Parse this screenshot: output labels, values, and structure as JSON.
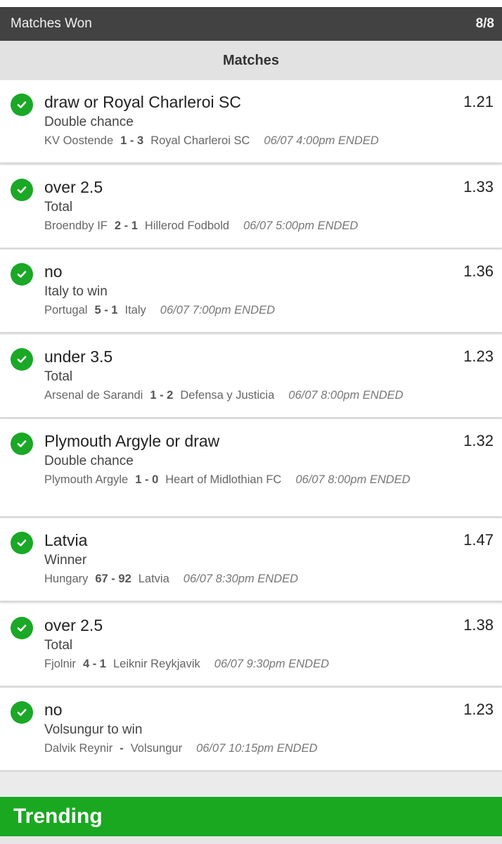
{
  "header": {
    "won_label": "Matches Won",
    "won_count": "8/8"
  },
  "section_title": "Matches",
  "matches": [
    {
      "selection": "draw or Royal Charleroi SC",
      "market": "Double chance",
      "odds": "1.21",
      "home": "KV Oostende",
      "score": "1 - 3",
      "away": "Royal Charleroi SC",
      "time": "06/07 4:00pm ENDED"
    },
    {
      "selection": "over 2.5",
      "market": "Total",
      "odds": "1.33",
      "home": "Broendby IF",
      "score": "2 - 1",
      "away": "Hillerod Fodbold",
      "time": "06/07 5:00pm ENDED"
    },
    {
      "selection": "no",
      "market": "Italy to win",
      "odds": "1.36",
      "home": "Portugal",
      "score": "5 - 1",
      "away": "Italy",
      "time": "06/07 7:00pm ENDED"
    },
    {
      "selection": "under 3.5",
      "market": "Total",
      "odds": "1.23",
      "home": "Arsenal de Sarandi",
      "score": "1 - 2",
      "away": "Defensa y Justicia",
      "time": "06/07 8:00pm ENDED"
    },
    {
      "selection": "Plymouth Argyle or draw",
      "market": "Double chance",
      "odds": "1.32",
      "home": "Plymouth Argyle",
      "score": "1 - 0",
      "away": "Heart of Midlothian FC",
      "time": "06/07 8:00pm ENDED"
    },
    {
      "selection": "Latvia",
      "market": "Winner",
      "odds": "1.47",
      "home": "Hungary",
      "score": "67 - 92",
      "away": "Latvia",
      "time": "06/07 8:30pm ENDED"
    },
    {
      "selection": "over 2.5",
      "market": "Total",
      "odds": "1.38",
      "home": "Fjolnir",
      "score": "4 - 1",
      "away": "Leiknir Reykjavik",
      "time": "06/07 9:30pm ENDED"
    },
    {
      "selection": "no",
      "market": "Volsungur to win",
      "odds": "1.23",
      "home": "Dalvik Reynir",
      "score": "-",
      "away": "Volsungur",
      "time": "06/07 10:15pm ENDED"
    }
  ],
  "trending_label": "Trending",
  "colors": {
    "won_bar": "#424242",
    "success_green": "#1aa826",
    "trending_green": "#1aa821"
  },
  "icons": {
    "status": "check-circle-icon"
  }
}
